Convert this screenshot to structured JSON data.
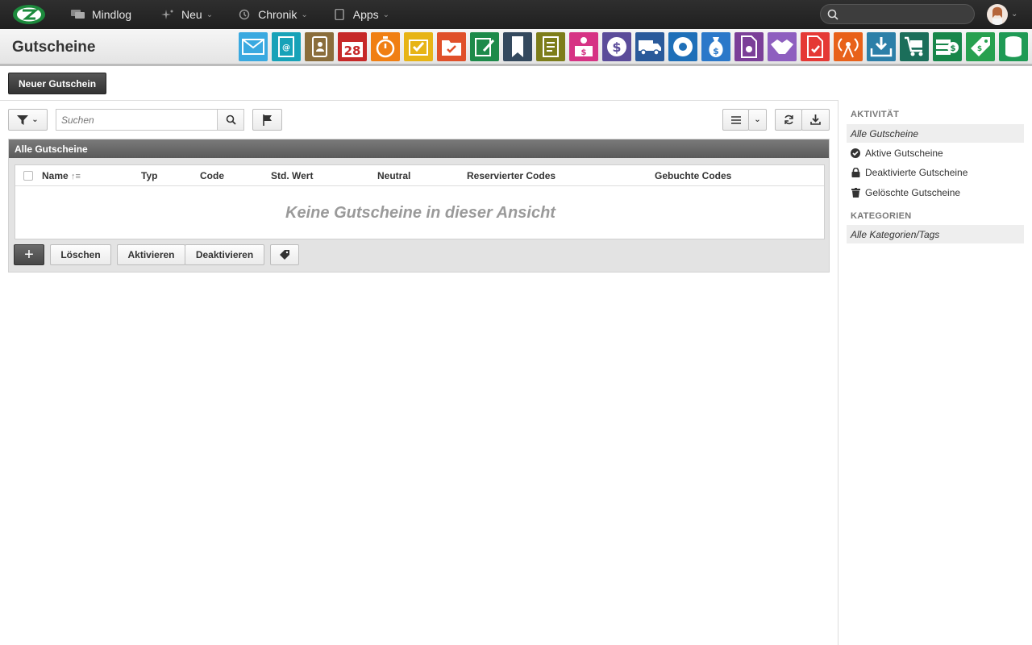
{
  "topnav": {
    "items": [
      {
        "label": "Mindlog",
        "icon": "chat-icon"
      },
      {
        "label": "Neu",
        "icon": "sparkle-icon"
      },
      {
        "label": "Chronik",
        "icon": "history-icon"
      },
      {
        "label": "Apps",
        "icon": "tablet-icon"
      }
    ]
  },
  "header": {
    "title": "Gutscheine",
    "calendar_day": "28"
  },
  "app_icon_colors": [
    "#3aa9e0",
    "#17a2b8",
    "#8a6d3b",
    "#c62828",
    "#f07f13",
    "#e7b416",
    "#e0502a",
    "#1d8a4a",
    "#34495e",
    "#7d7d1a",
    "#d63384",
    "#5b4c9a",
    "#2a5a9a",
    "#1e6fb8",
    "#2b78c9",
    "#7b3f98",
    "#8e5fbf",
    "#e53935",
    "#e8611a",
    "#2c7fa8",
    "#1b6e5a",
    "#17864a",
    "#27a04f",
    "#1f9a55"
  ],
  "actions": {
    "new_button": "Neuer Gutschein"
  },
  "toolbar": {
    "search_placeholder": "Suchen"
  },
  "panel": {
    "title": "Alle Gutscheine",
    "columns": [
      "Name",
      "Typ",
      "Code",
      "Std. Wert",
      "Neutral",
      "Reservierter Codes",
      "Gebuchte Codes"
    ],
    "empty_message": "Keine Gutscheine in dieser Ansicht",
    "buttons": {
      "delete": "Löschen",
      "activate": "Aktivieren",
      "deactivate": "Deaktivieren"
    }
  },
  "sidebar": {
    "activity_heading": "AKTIVITÄT",
    "activity_items": [
      {
        "label": "Alle Gutscheine",
        "selected": true
      },
      {
        "label": "Aktive Gutscheine",
        "icon": "check-circle-icon"
      },
      {
        "label": "Deaktivierte Gutscheine",
        "icon": "lock-icon"
      },
      {
        "label": "Gelöschte Gutscheine",
        "icon": "trash-icon"
      }
    ],
    "categories_heading": "KATEGORIEN",
    "category_items": [
      {
        "label": "Alle Kategorien/Tags",
        "selected": true
      }
    ]
  }
}
